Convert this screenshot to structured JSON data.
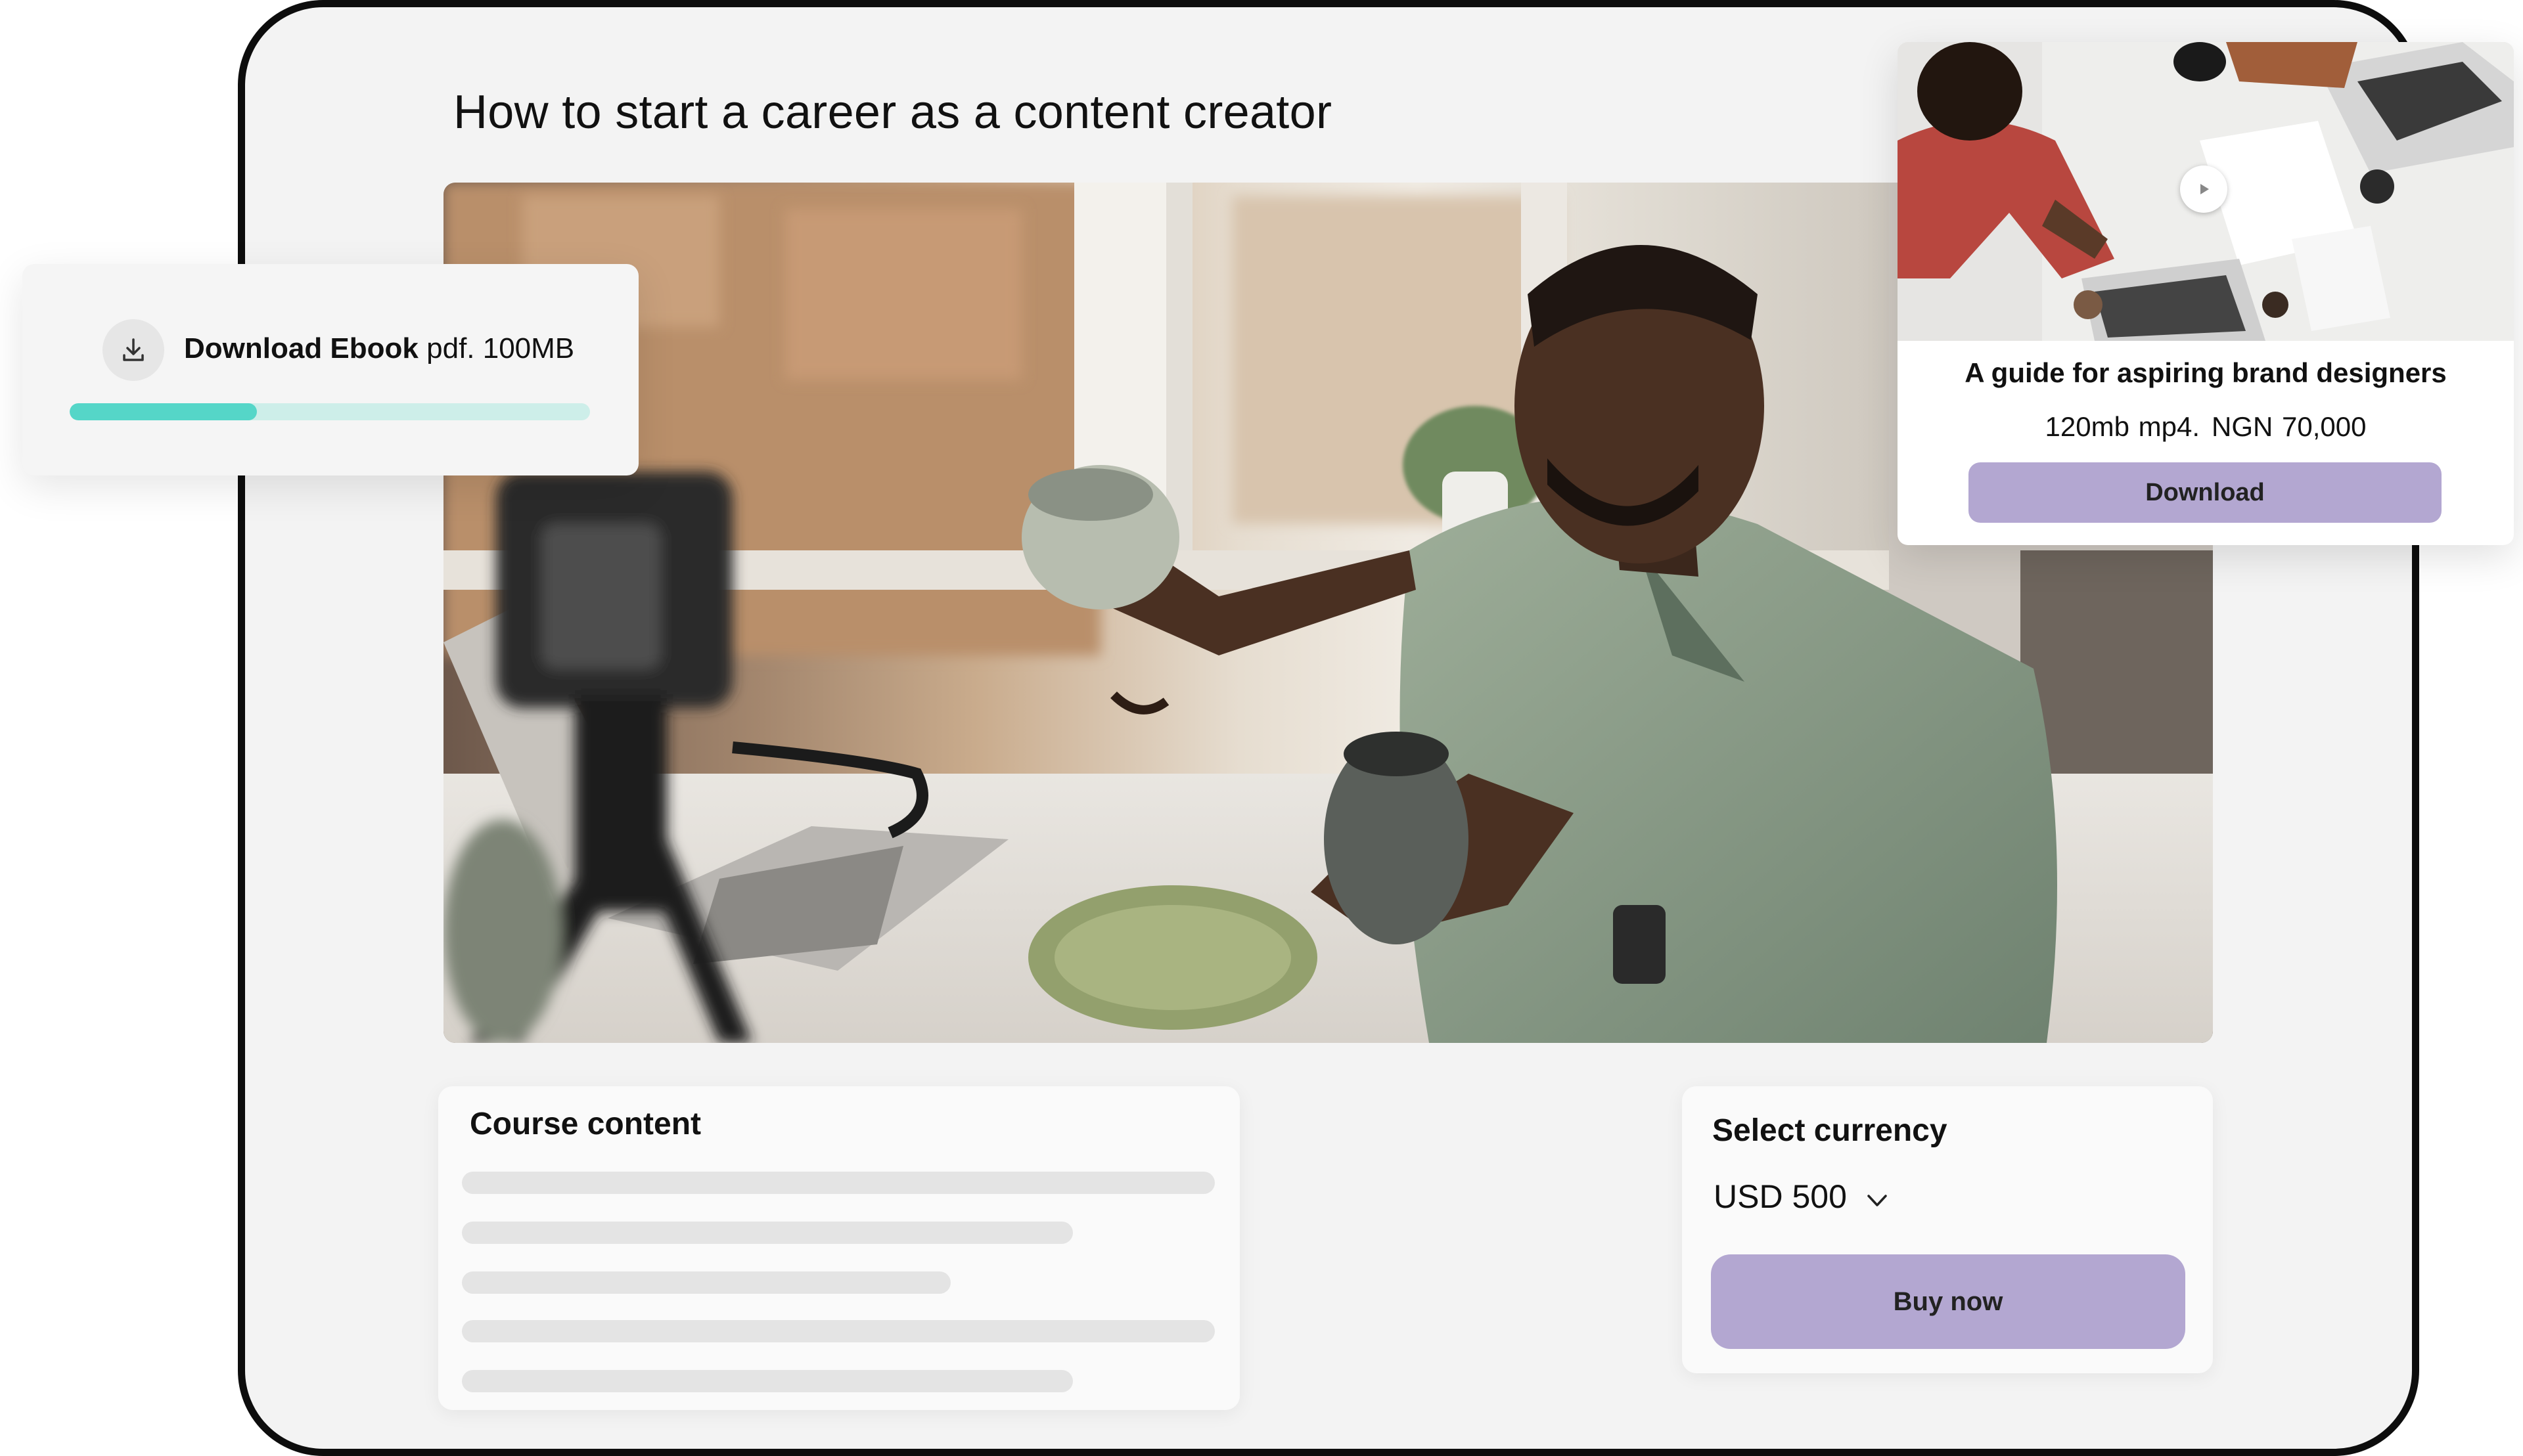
{
  "page": {
    "title": "How to start a career as a content creator"
  },
  "hero": {
    "icon": "hero-photo"
  },
  "course_content": {
    "title": "Course content",
    "skeleton_lines": 5
  },
  "currency": {
    "label": "Select currency",
    "selected": "USD 500",
    "buy_label": "Buy now"
  },
  "ebook": {
    "title": "Download Ebook",
    "meta": "pdf. 100MB",
    "progress": 0.36,
    "colors": {
      "fill": "#55d6c8",
      "track": "#cdeee9"
    }
  },
  "guide": {
    "title": "A guide for aspiring brand designers",
    "size": "120mb mp4.",
    "price": "NGN 70,000",
    "download_label": "Download"
  },
  "colors": {
    "accent": "#b3a7d1",
    "frame": "#0d0d0d",
    "surface": "#f3f3f3"
  }
}
